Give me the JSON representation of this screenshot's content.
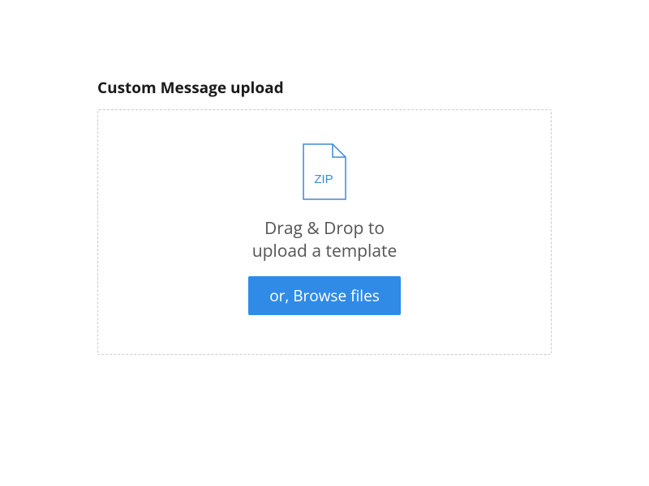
{
  "section": {
    "title": "Custom Message upload"
  },
  "dropzone": {
    "icon_label": "ZIP",
    "instruction_line1": "Drag & Drop to",
    "instruction_line2": "upload a template",
    "browse_button_label": "or, Browse files"
  },
  "colors": {
    "accent": "#2f8be6",
    "icon_stroke": "#3e89d6"
  }
}
